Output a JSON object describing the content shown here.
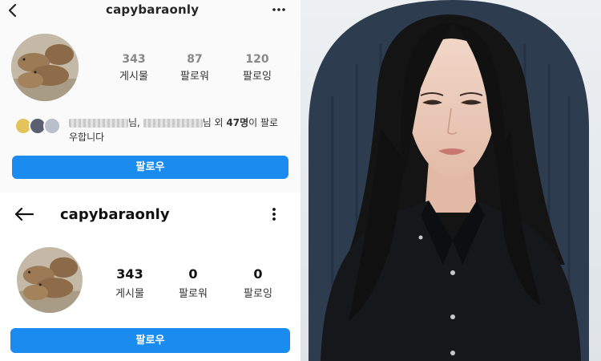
{
  "top_screenshot": {
    "username": "capybaraonly",
    "stats": [
      {
        "value": "343",
        "label": "게시물"
      },
      {
        "value": "87",
        "label": "팔로워"
      },
      {
        "value": "120",
        "label": "팔로잉"
      }
    ],
    "followed_by": {
      "suffix_1": "님,",
      "suffix_2": "님",
      "middle": " 외 ",
      "count": "47명",
      "tail": "이 팔로",
      "tail2": "우합니다"
    },
    "follow_button": "팔로우"
  },
  "bottom_screenshot": {
    "username": "capybaraonly",
    "stats": [
      {
        "value": "343",
        "label": "게시물"
      },
      {
        "value": "0",
        "label": "팔로워"
      },
      {
        "value": "0",
        "label": "팔로잉"
      }
    ],
    "follow_button": "팔로우"
  },
  "colors": {
    "follow_blue": "#1a8cf0",
    "backdrop_navy": "#2e3c50"
  },
  "icons": [
    "back-chevron-icon",
    "more-dots-icon",
    "back-arrow-icon",
    "more-vertical-icon"
  ]
}
